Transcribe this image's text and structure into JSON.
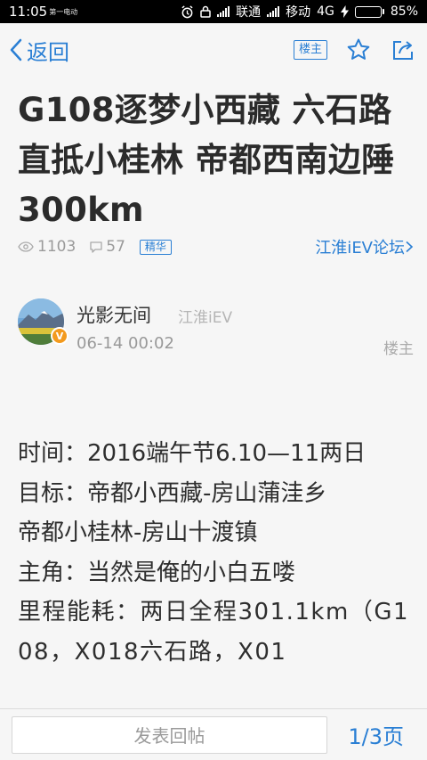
{
  "status_bar": {
    "time": "11:05",
    "carrier_small": "第一电动",
    "carrier1": "联通",
    "carrier2": "移动",
    "network": "4G",
    "battery": "85%",
    "battery_level": 0.85
  },
  "nav": {
    "back_label": "返回",
    "floor_badge": "楼主"
  },
  "post": {
    "title": "G108逐梦小西藏 六石路直抵小桂林 帝都西南边陲300km",
    "views": "1103",
    "comments": "57",
    "tag": "精华",
    "forum_link": "江淮iEV论坛"
  },
  "author": {
    "name": "光影无间",
    "forum": "江淮iEV",
    "time": "06-14 00:02",
    "role": "楼主",
    "verified_mark": "V"
  },
  "content": {
    "lines": [
      "时间：2016端午节6.10—11两日",
      "目标：帝都小西藏-房山蒲洼乡",
      "帝都小桂林-房山十渡镇",
      "主角：当然是俺的小白五喽",
      "里程能耗：两日全程301.1km（G108，X018六石路，X01"
    ]
  },
  "bottom": {
    "reply_placeholder": "发表回帖",
    "page_indicator": "1/3页"
  },
  "colors": {
    "accent": "#2a7fd4",
    "badge": "#f39a1e"
  }
}
